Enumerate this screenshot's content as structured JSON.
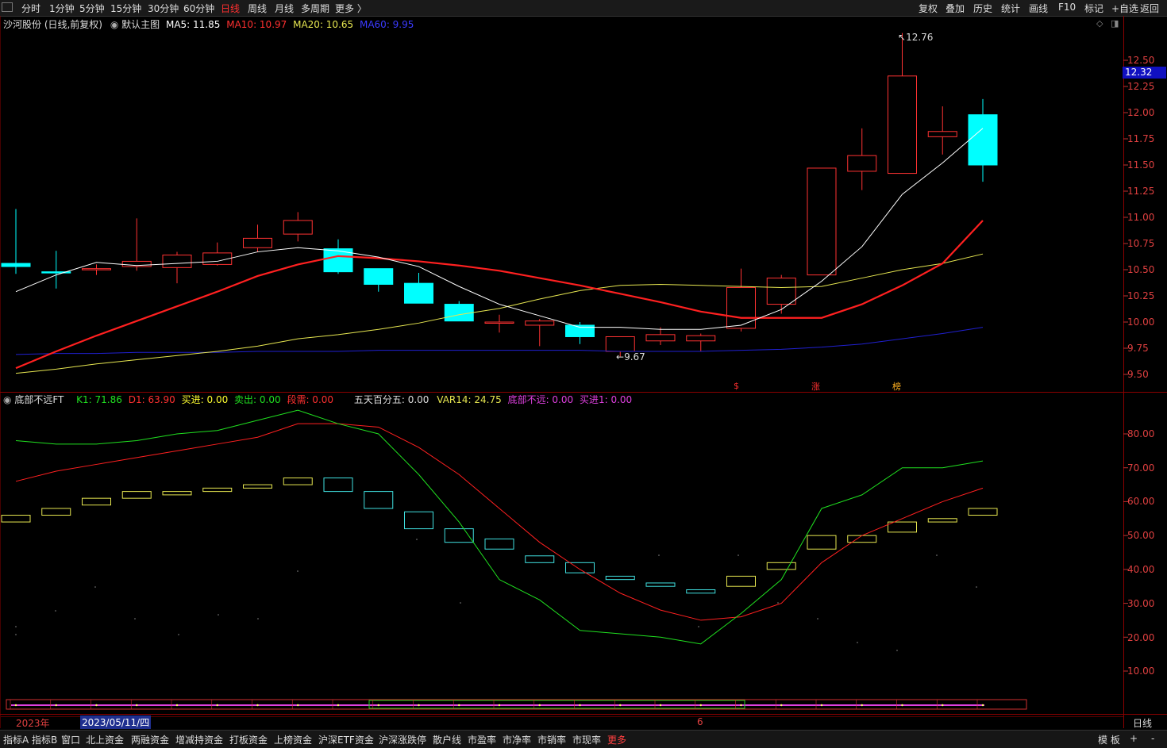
{
  "toolbar": {
    "periods": [
      "分时",
      "1分钟",
      "5分钟",
      "15分钟",
      "30分钟",
      "60分钟",
      "日线",
      "周线",
      "月线",
      "多周期",
      "更多 〉"
    ],
    "active_period": "日线",
    "right_actions": [
      "复权",
      "叠加",
      "历史",
      "统计",
      "画线",
      "F10",
      "标记",
      "+自选",
      "返回"
    ]
  },
  "main_panel": {
    "stock": "沙河股份 (日线,前复权)",
    "indicator": "默认主图",
    "ma5": "MA5: 11.85",
    "ma10": "MA10: 10.97",
    "ma20": "MA20: 10.65",
    "ma60": "MA60: 9.95",
    "high_label": "12.76",
    "low_label": "9.67",
    "current_price": "12.32",
    "markers": [
      "$",
      "涨",
      "榜"
    ],
    "y_ticks": [
      "12.50",
      "12.25",
      "12.00",
      "11.75",
      "11.50",
      "11.25",
      "11.00",
      "10.75",
      "10.50",
      "10.25",
      "10.00",
      "9.75",
      "9.50"
    ]
  },
  "sub_panel": {
    "name": "底部不远FT",
    "k1": "K1: 71.86",
    "d1": "D1: 63.90",
    "buy": "买进: 0.00",
    "sell": "卖出: 0.00",
    "short": "段需: 0.00",
    "five_day": "五天百分五: 0.00",
    "var14": "VAR14: 24.75",
    "bottom_near": "底部不远: 0.00",
    "buy1": "买进1: 0.00",
    "y_ticks": [
      "80.00",
      "70.00",
      "60.00",
      "50.00",
      "40.00",
      "30.00",
      "20.00",
      "10.00"
    ]
  },
  "timeline": {
    "year": "2023年",
    "cursor_date": "2023/05/11/四",
    "month_mark": "6",
    "period_label": "日线"
  },
  "bottom_tabs": [
    "指标A",
    "指标B",
    "窗口",
    "北上资金",
    "两融资金",
    "增减持资金",
    "打板资金",
    "上榜资金",
    "沪深ETF资金",
    "沪深涨跌停",
    "散户线",
    "市盈率",
    "市净率",
    "市销率",
    "市现率",
    "更多"
  ],
  "bottom_right": [
    "模 板",
    "+",
    "-"
  ],
  "colors": {
    "up": "#ff3232",
    "down": "#00ffff",
    "ma5": "#ffffff",
    "ma10": "#ff2020",
    "ma20": "#e6e650",
    "ma60": "#2020d0",
    "k1": "#20e020",
    "d1": "#ff2020"
  },
  "chart_data": [
    {
      "type": "candlestick",
      "title": "沙河股份 (日线,前复权)",
      "ylim": [
        9.4,
        12.85
      ],
      "candles": [
        {
          "o": 10.56,
          "h": 11.08,
          "l": 10.46,
          "c": 10.53
        },
        {
          "o": 10.48,
          "h": 10.68,
          "l": 10.32,
          "c": 10.47
        },
        {
          "o": 10.51,
          "h": 10.55,
          "l": 10.45,
          "c": 10.51
        },
        {
          "o": 10.53,
          "h": 10.99,
          "l": 10.49,
          "c": 10.58
        },
        {
          "o": 10.52,
          "h": 10.67,
          "l": 10.37,
          "c": 10.64
        },
        {
          "o": 10.55,
          "h": 10.76,
          "l": 10.54,
          "c": 10.66
        },
        {
          "o": 10.71,
          "h": 10.93,
          "l": 10.67,
          "c": 10.8
        },
        {
          "o": 10.84,
          "h": 11.05,
          "l": 10.77,
          "c": 10.97
        },
        {
          "o": 10.7,
          "h": 10.79,
          "l": 10.46,
          "c": 10.48
        },
        {
          "o": 10.51,
          "h": 10.51,
          "l": 10.29,
          "c": 10.36
        },
        {
          "o": 10.37,
          "h": 10.47,
          "l": 10.18,
          "c": 10.18
        },
        {
          "o": 10.17,
          "h": 10.2,
          "l": 10.01,
          "c": 10.01
        },
        {
          "o": 10.0,
          "h": 10.07,
          "l": 9.9,
          "c": 10.0
        },
        {
          "o": 9.97,
          "h": 10.03,
          "l": 9.77,
          "c": 10.01
        },
        {
          "o": 9.97,
          "h": 10.0,
          "l": 9.79,
          "c": 9.86
        },
        {
          "o": 9.72,
          "h": 9.86,
          "l": 9.67,
          "c": 9.86
        },
        {
          "o": 9.82,
          "h": 9.95,
          "l": 9.78,
          "c": 9.88
        },
        {
          "o": 9.82,
          "h": 9.89,
          "l": 9.72,
          "c": 9.87
        },
        {
          "o": 9.94,
          "h": 10.51,
          "l": 9.91,
          "c": 10.33
        },
        {
          "o": 10.17,
          "h": 10.45,
          "l": 10.08,
          "c": 10.42
        },
        {
          "o": 10.45,
          "h": 11.47,
          "l": 10.45,
          "c": 11.47
        },
        {
          "o": 11.44,
          "h": 11.85,
          "l": 11.26,
          "c": 11.59
        },
        {
          "o": 11.42,
          "h": 12.76,
          "l": 11.42,
          "c": 12.35
        },
        {
          "o": 11.77,
          "h": 12.06,
          "l": 11.6,
          "c": 11.82
        },
        {
          "o": 11.98,
          "h": 12.13,
          "l": 11.34,
          "c": 11.5
        }
      ],
      "ma5": [
        10.29,
        10.45,
        10.57,
        10.54,
        10.56,
        10.58,
        10.67,
        10.71,
        10.68,
        10.62,
        10.53,
        10.34,
        10.17,
        10.06,
        9.95,
        9.95,
        9.93,
        9.93,
        9.97,
        10.12,
        10.39,
        10.72,
        11.22,
        11.52,
        11.85
      ],
      "ma10": [
        9.56,
        9.72,
        9.87,
        10.01,
        10.15,
        10.29,
        10.44,
        10.55,
        10.63,
        10.61,
        10.58,
        10.54,
        10.49,
        10.42,
        10.35,
        10.27,
        10.19,
        10.1,
        10.04,
        10.04,
        10.04,
        10.17,
        10.35,
        10.56,
        10.97
      ],
      "ma20": [
        9.51,
        9.55,
        9.6,
        9.64,
        9.68,
        9.72,
        9.77,
        9.84,
        9.88,
        9.93,
        9.99,
        10.07,
        10.13,
        10.22,
        10.3,
        10.35,
        10.36,
        10.35,
        10.34,
        10.33,
        10.34,
        10.42,
        10.5,
        10.56,
        10.65
      ],
      "ma60": [
        9.69,
        9.7,
        9.7,
        9.71,
        9.71,
        9.71,
        9.72,
        9.72,
        9.72,
        9.73,
        9.73,
        9.73,
        9.73,
        9.73,
        9.73,
        9.72,
        9.72,
        9.72,
        9.73,
        9.74,
        9.76,
        9.79,
        9.84,
        9.89,
        9.95
      ]
    },
    {
      "type": "line",
      "title": "底部不远FT",
      "ylim": [
        0,
        90
      ],
      "series": [
        {
          "name": "K1",
          "values": [
            78,
            77,
            77,
            78,
            80,
            81,
            84,
            87,
            83,
            80,
            68,
            54,
            37,
            31,
            22,
            21,
            20,
            18,
            27,
            37,
            58,
            62,
            70,
            70,
            72
          ]
        },
        {
          "name": "D1",
          "values": [
            66,
            69,
            71,
            73,
            75,
            77,
            79,
            83,
            83,
            82,
            76,
            68,
            58,
            48,
            40,
            33,
            28,
            25,
            26,
            30,
            42,
            50,
            55,
            60,
            64
          ]
        }
      ],
      "boxes": [
        [
          54,
          56
        ],
        [
          56,
          58
        ],
        [
          59,
          61
        ],
        [
          61,
          63
        ],
        [
          62,
          63
        ],
        [
          63,
          64
        ],
        [
          64,
          65
        ],
        [
          65,
          67
        ],
        [
          63,
          67
        ],
        [
          58,
          63
        ],
        [
          52,
          57
        ],
        [
          48,
          52
        ],
        [
          46,
          49
        ],
        [
          42,
          44
        ],
        [
          39,
          42
        ],
        [
          37,
          38
        ],
        [
          35,
          36
        ],
        [
          33,
          34
        ],
        [
          35,
          38
        ],
        [
          40,
          42
        ],
        [
          46,
          50
        ],
        [
          48,
          50
        ],
        [
          51,
          54
        ],
        [
          54,
          55
        ],
        [
          56,
          58
        ]
      ]
    }
  ]
}
